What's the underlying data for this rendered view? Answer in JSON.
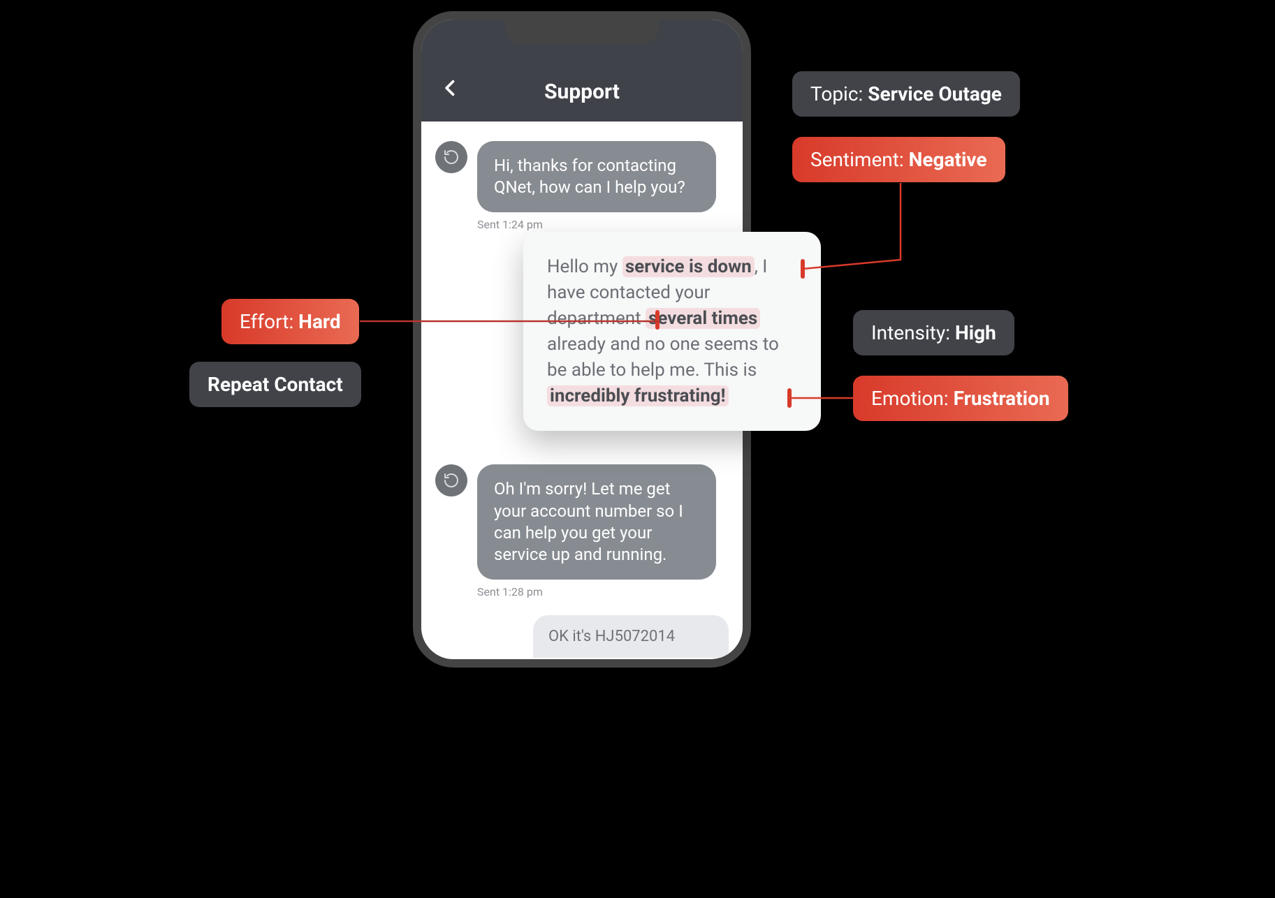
{
  "header": {
    "title": "Support"
  },
  "messages": {
    "m1": {
      "text": "Hi, thanks for contacting QNet, how can I help you?",
      "sent": "Sent 1:24 pm"
    },
    "m2": {
      "text": "Oh I'm sorry! Let me get your account number so I can help you get your service up and running.",
      "sent": "Sent 1:28 pm"
    },
    "peek": "OK it's HJ5072014"
  },
  "user_message": {
    "pre1": "Hello my ",
    "hl1": "service is down",
    "post1": ", I have contacted your department ",
    "hl2": "several times",
    "post2": " already and no one seems to be able to help me. This is ",
    "hl3": "incredibly frustrating!"
  },
  "tags": {
    "topic": {
      "label": "Topic: ",
      "value": "Service Outage"
    },
    "sentiment": {
      "label": "Sentiment: ",
      "value": "Negative"
    },
    "effort": {
      "label": "Effort: ",
      "value": "Hard"
    },
    "repeat": {
      "value": "Repeat Contact"
    },
    "intensity": {
      "label": "Intensity: ",
      "value": "High"
    },
    "emotion": {
      "label": "Emotion: ",
      "value": "Frustration"
    }
  }
}
